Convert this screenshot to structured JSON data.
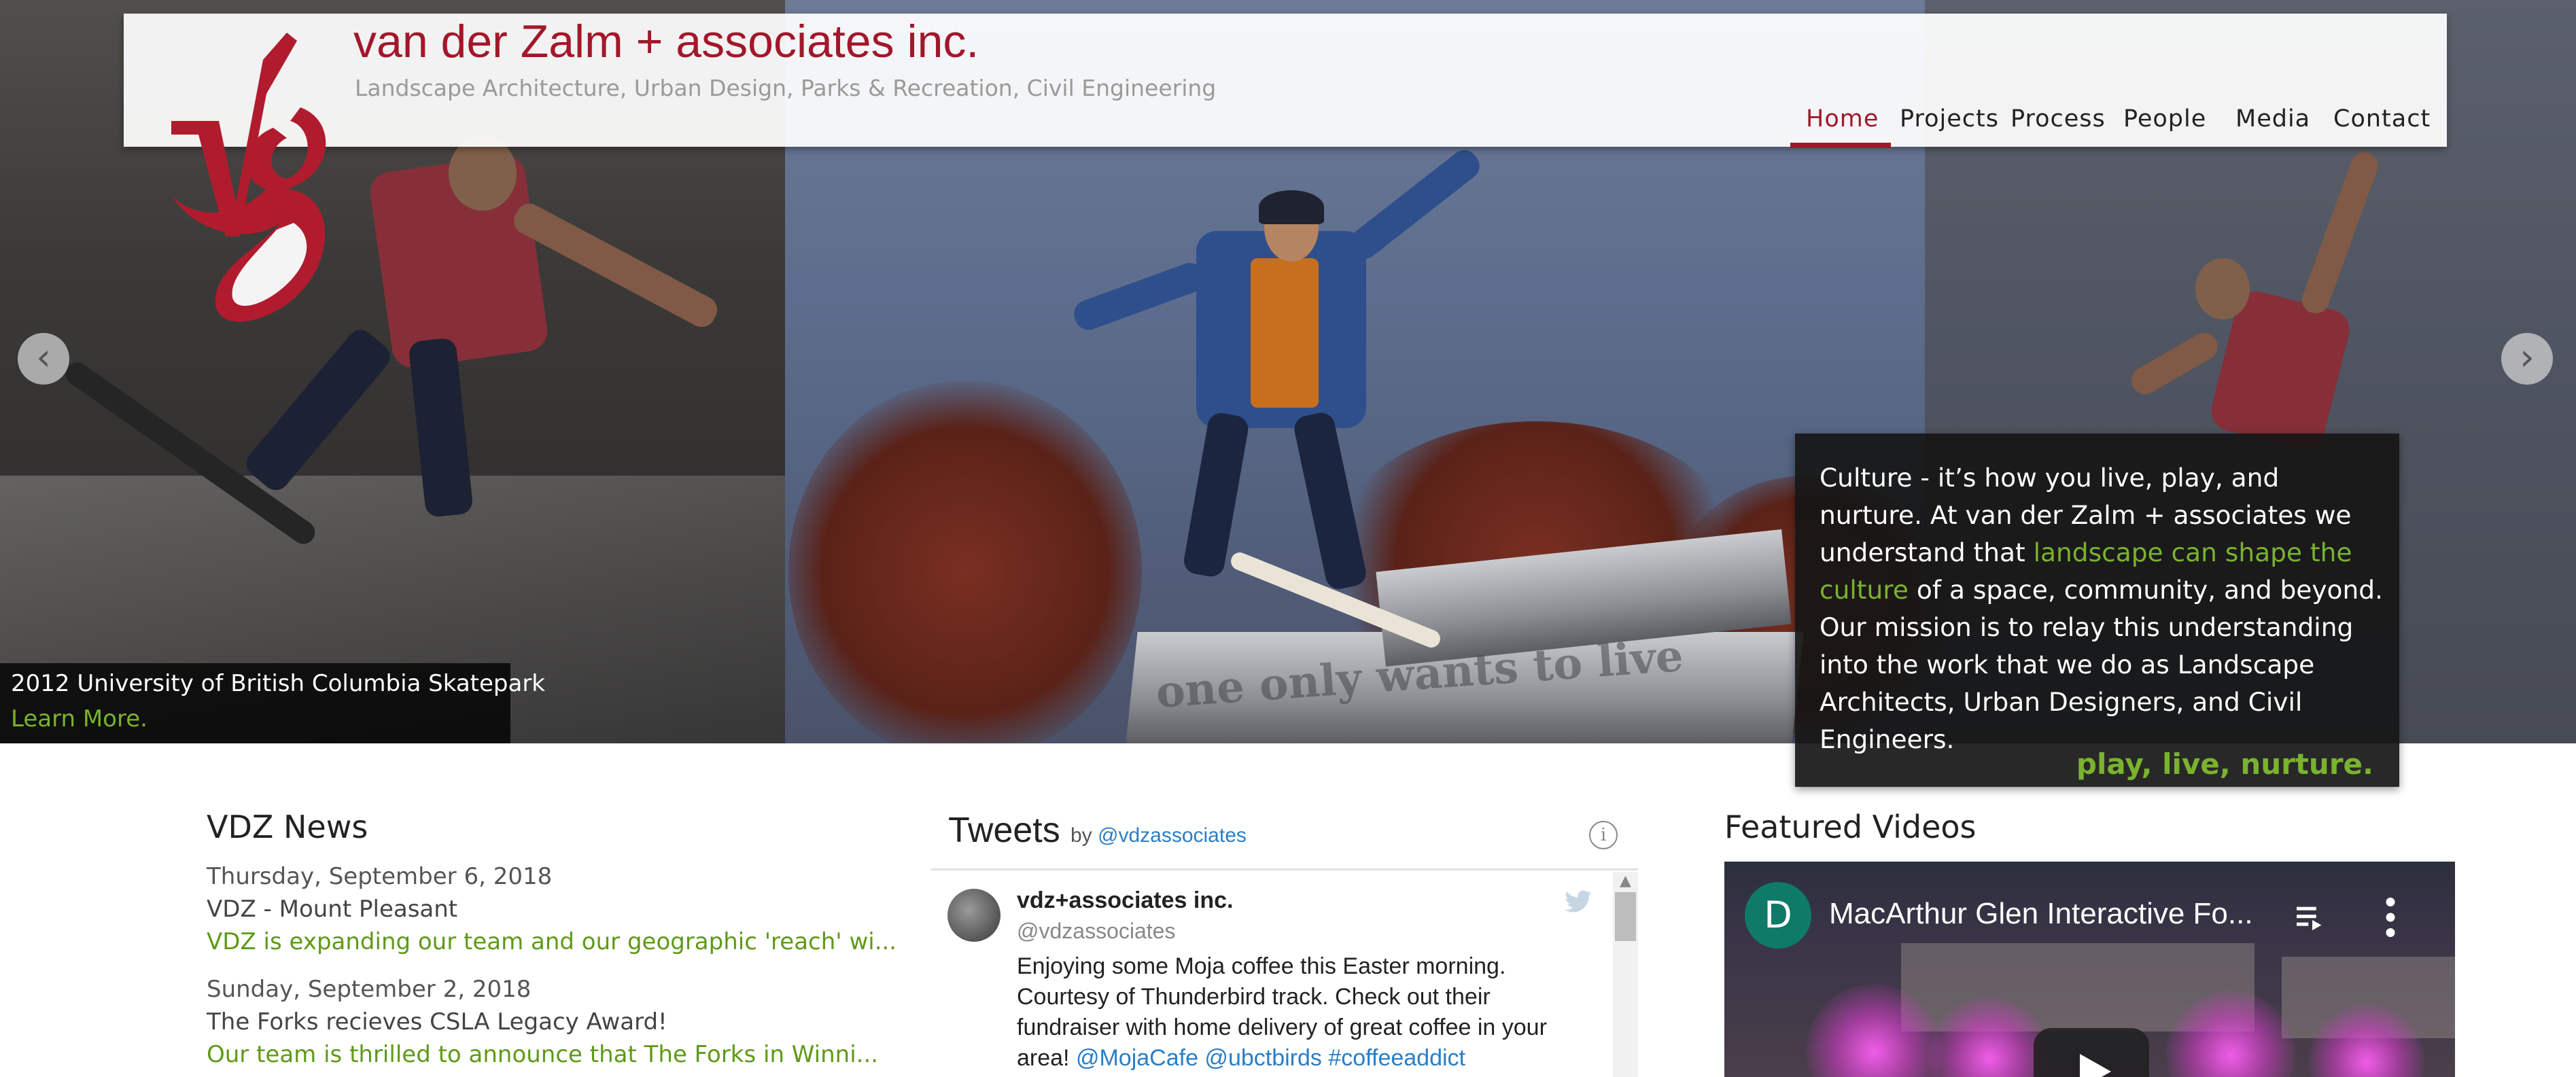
{
  "header": {
    "title": "van der Zalm + associates inc.",
    "tagline": "Landscape Architecture, Urban Design, Parks & Recreation, Civil Engineering",
    "logo": "vdz-logo"
  },
  "nav": {
    "items": [
      {
        "label": "Home",
        "active": true
      },
      {
        "label": "Projects",
        "active": false
      },
      {
        "label": "Process",
        "active": false
      },
      {
        "label": "People",
        "active": false
      },
      {
        "label": "Media",
        "active": false
      },
      {
        "label": "Contact",
        "active": false
      }
    ]
  },
  "slider": {
    "prev_icon": "arrow-left-icon",
    "next_icon": "arrow-right-icon",
    "caption_title": "2012 University of British Columbia Skatepark",
    "caption_link": "Learn More.",
    "ledge_text": "one only wants to live"
  },
  "mission": {
    "text_before": "Culture - it’s how you live, play, and nurture. At van der Zalm + associates we understand that ",
    "highlight": "landscape can shape the culture",
    "text_after": " of a space, community, and beyond. Our mission is to relay this understanding into the work that we do as Landscape Architects, Urban Designers, and Civil Engineers.",
    "slogan": "play, live, nurture."
  },
  "news": {
    "title": "VDZ News",
    "items": [
      {
        "date": "Thursday, September 6, 2018",
        "headline": "VDZ - Mount Pleasant",
        "excerpt": "VDZ is expanding our team and our geographic 'reach' wi..."
      },
      {
        "date": "Sunday, September 2, 2018",
        "headline": "The Forks recieves CSLA Legacy Award!",
        "excerpt": "Our team is thrilled to announce that The Forks in Winni..."
      }
    ]
  },
  "tweets": {
    "title": "Tweets",
    "by": "by",
    "handle": "@vdzassociates",
    "tweet": {
      "name": "vdz+associates inc.",
      "user": "@vdzassociates",
      "text": "Enjoying some Moja coffee this Easter morning. Courtesy of Thunderbird track. Check out their fundraiser with home delivery of great coffee in your area! ",
      "links": "@MojaCafe @ubctbirds #coffeeaddict"
    }
  },
  "videos": {
    "title": "Featured Videos",
    "channel_initial": "D",
    "video_title": "MacArthur Glen Interactive Fo..."
  },
  "colors": {
    "brand_red": "#a3172a",
    "accent_green": "#7ab32e",
    "link_blue": "#2a7ec6"
  }
}
